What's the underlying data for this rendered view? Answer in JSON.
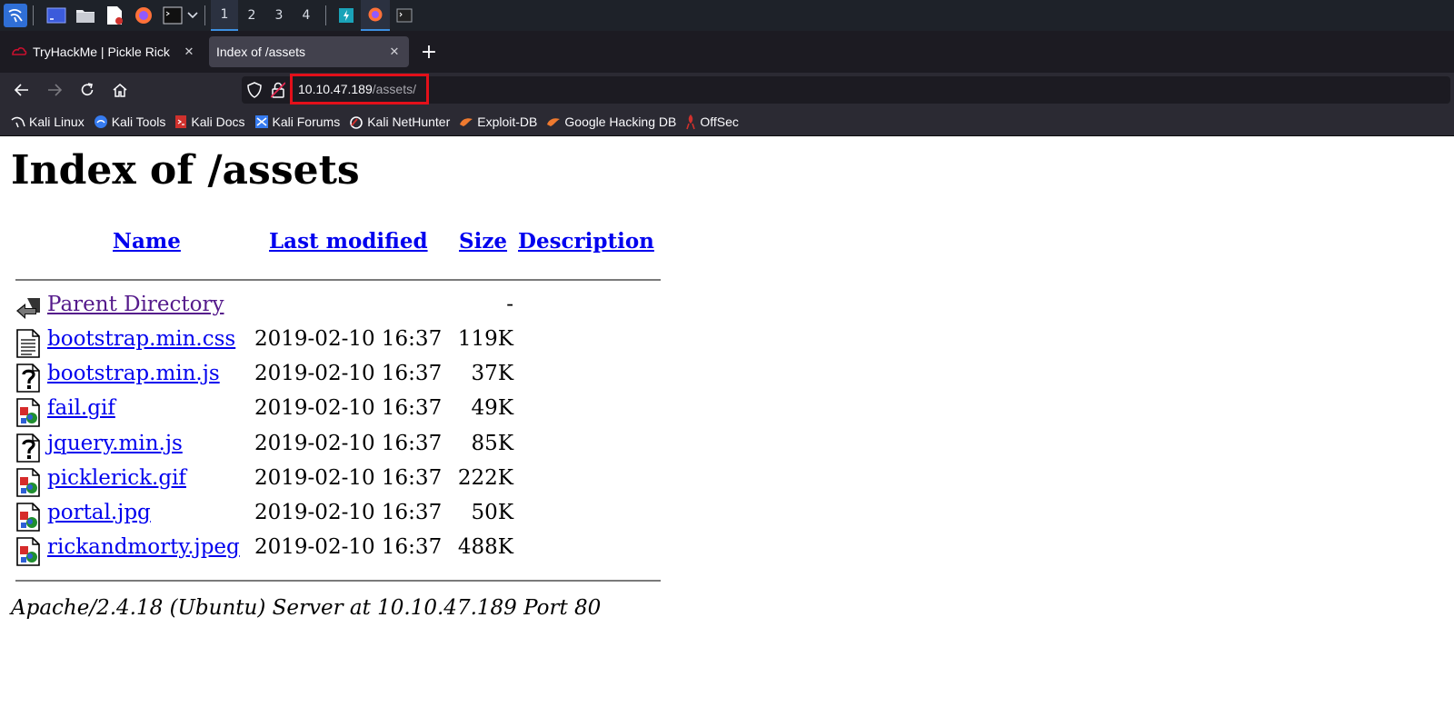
{
  "taskbar": {
    "workspaces": [
      "1",
      "2",
      "3",
      "4"
    ],
    "active_workspace": "1"
  },
  "browser": {
    "tabs": [
      {
        "title": "TryHackMe | Pickle Rick",
        "close": "✕"
      },
      {
        "title": "Index of /assets",
        "close": "✕"
      }
    ],
    "new_tab": "+",
    "url_host": "10.10.47.189",
    "url_path": "/assets/",
    "bookmarks": [
      "Kali Linux",
      "Kali Tools",
      "Kali Docs",
      "Kali Forums",
      "Kali NetHunter",
      "Exploit-DB",
      "Google Hacking DB",
      "OffSec"
    ]
  },
  "page": {
    "title": "Index of /assets",
    "columns": {
      "name": "Name",
      "modified": "Last modified",
      "size": "Size",
      "description": "Description"
    },
    "parent": {
      "name": "Parent Directory",
      "size": "-"
    },
    "files": [
      {
        "name": "bootstrap.min.css",
        "modified": "2019-02-10 16:37",
        "size": "119K",
        "icon": "text-file-icon"
      },
      {
        "name": "bootstrap.min.js",
        "modified": "2019-02-10 16:37",
        "size": "37K",
        "icon": "unknown-file-icon"
      },
      {
        "name": "fail.gif",
        "modified": "2019-02-10 16:37",
        "size": "49K",
        "icon": "image-file-icon"
      },
      {
        "name": "jquery.min.js",
        "modified": "2019-02-10 16:37",
        "size": "85K",
        "icon": "unknown-file-icon"
      },
      {
        "name": "picklerick.gif",
        "modified": "2019-02-10 16:37",
        "size": "222K",
        "icon": "image-file-icon"
      },
      {
        "name": "portal.jpg",
        "modified": "2019-02-10 16:37",
        "size": "50K",
        "icon": "image-file-icon"
      },
      {
        "name": "rickandmorty.jpeg",
        "modified": "2019-02-10 16:37",
        "size": "488K",
        "icon": "image-file-icon"
      }
    ],
    "footer": "Apache/2.4.18 (Ubuntu) Server at 10.10.47.189 Port 80"
  },
  "colors": {
    "link": "#0000ee",
    "visited": "#551a8b",
    "highlight": "#e3101a"
  }
}
